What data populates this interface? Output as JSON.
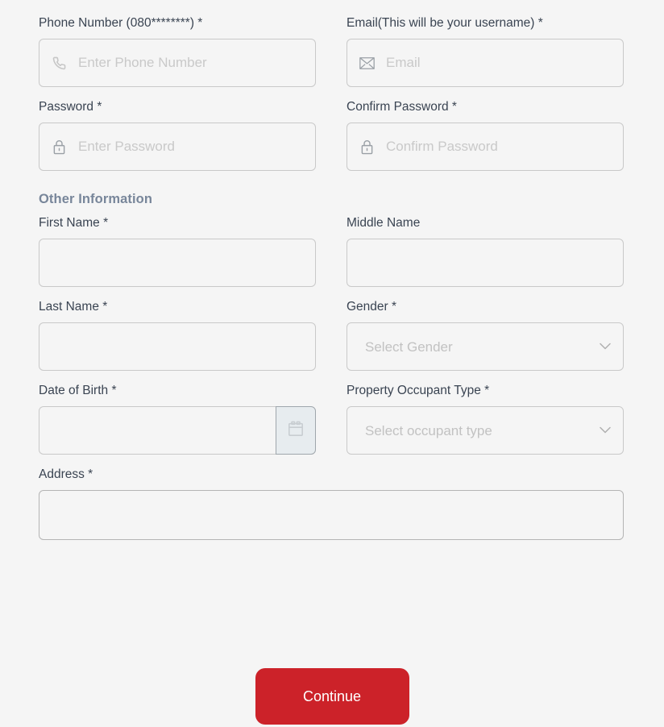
{
  "theme": {
    "page_bg": "#f5f5f5",
    "field_bg": "#f5f5f5",
    "border": "#c9c9c9",
    "label_color": "#3a4452",
    "section_color": "#78869a",
    "placeholder_color": "#c6c6c6",
    "accent_red": "#cc2229",
    "cal_btn_bg": "#e7ecef"
  },
  "form": {
    "phone": {
      "label": "Phone Number (080********) *",
      "placeholder": "Enter Phone Number",
      "value": "",
      "icon": "phone-icon"
    },
    "email": {
      "label": "Email(This will be your username) *",
      "placeholder": "Email",
      "value": "",
      "icon": "envelope-icon"
    },
    "password": {
      "label": "Password *",
      "placeholder": "Enter Password",
      "value": "",
      "icon": "lock-icon"
    },
    "confirm_password": {
      "label": "Confirm Password *",
      "placeholder": "Confirm Password",
      "value": "",
      "icon": "lock-icon"
    },
    "section_other": "Other Information",
    "first_name": {
      "label": "First Name *",
      "placeholder": "",
      "value": ""
    },
    "middle_name": {
      "label": "Middle Name",
      "placeholder": "",
      "value": ""
    },
    "last_name": {
      "label": "Last Name *",
      "placeholder": "",
      "value": ""
    },
    "gender": {
      "label": "Gender *",
      "selected": "Select Gender",
      "icon": "chevron-down-icon"
    },
    "date_of_birth": {
      "label": "Date of Birth *",
      "placeholder": "",
      "value": "",
      "icon": "calendar-icon"
    },
    "occupant_type": {
      "label": "Property Occupant Type *",
      "selected": "Select occupant type",
      "icon": "chevron-down-icon"
    },
    "address": {
      "label": "Address *",
      "placeholder": "",
      "value": ""
    }
  },
  "actions": {
    "continue_label": "Continue"
  }
}
